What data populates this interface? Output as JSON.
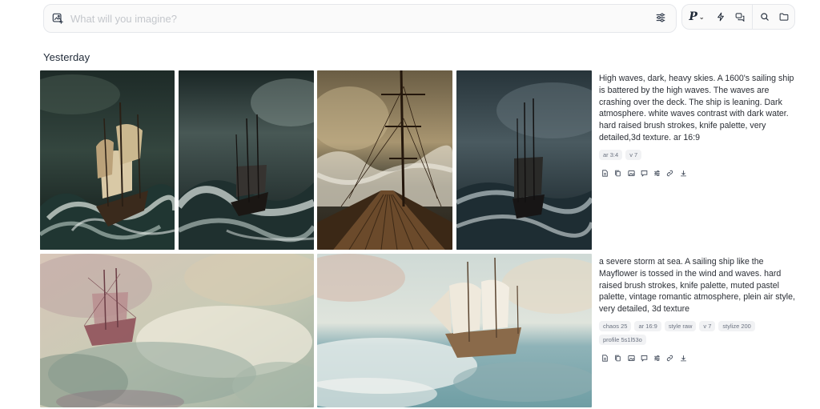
{
  "search": {
    "placeholder": "What will you imagine?",
    "value": ""
  },
  "toolbar": {
    "personalize_label": "P",
    "icons": [
      "personalize-icon",
      "lightning-icon",
      "chat-icon",
      "search-icon",
      "folder-icon"
    ]
  },
  "section": {
    "title": "Yesterday"
  },
  "jobs": [
    {
      "prompt": "High waves, dark, heavy skies. A 1600's sailing ship is battered by the high waves. The waves are crashing over the deck. The ship is leaning. Dark atmosphere. white waves contrast with dark water. hard raised brush strokes, knife palette, very detailed,3d texture. ar 16:9",
      "tags": [
        "ar 3:4",
        "v 7"
      ],
      "images": [
        "ship-dark-storm-1",
        "ship-dark-storm-2",
        "ship-deck-storm-3",
        "ship-dark-storm-4"
      ],
      "actions": [
        "use-prompt-icon",
        "copy-icon",
        "use-image-icon",
        "comment-icon",
        "settings-icon",
        "link-icon",
        "download-icon"
      ]
    },
    {
      "prompt": "a severe storm at sea. A sailing ship like the Mayflower is tossed in the wind and waves. hard raised brush strokes, knife palette, muted pastel palette, vintage romantic atmosphere, plein air style, very detailed, 3d texture",
      "tags": [
        "chaos 25",
        "ar 16:9",
        "style raw",
        "v 7",
        "stylize 200",
        "profile 5s1l53o"
      ],
      "images": [
        "ship-pastel-storm-1",
        "ship-pastel-storm-2"
      ],
      "actions": [
        "use-prompt-icon",
        "copy-icon",
        "use-image-icon",
        "comment-icon",
        "settings-icon",
        "link-icon",
        "download-icon"
      ]
    }
  ],
  "colors": {
    "accent_dark": "#1f2937",
    "muted_text": "#6b7280",
    "border": "#e5e7eb"
  }
}
